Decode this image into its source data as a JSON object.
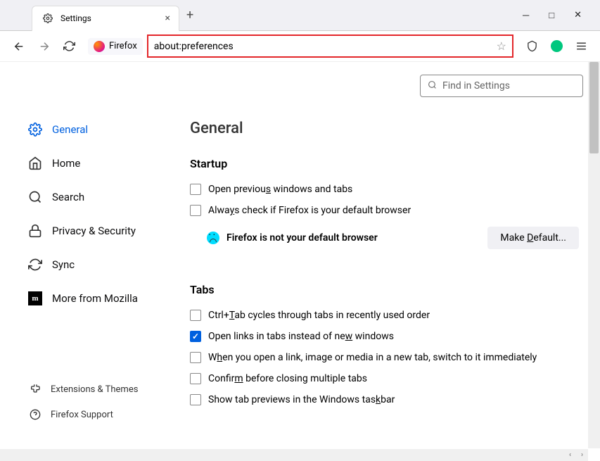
{
  "tab": {
    "title": "Settings"
  },
  "url": {
    "identity": "Firefox",
    "value": "about:preferences"
  },
  "search": {
    "placeholder": "Find in Settings"
  },
  "sidebar": {
    "general": "General",
    "home": "Home",
    "search": "Search",
    "privacy": "Privacy & Security",
    "sync": "Sync",
    "more": "More from Mozilla",
    "ext": "Extensions & Themes",
    "support": "Firefox Support"
  },
  "page": {
    "title": "General",
    "startup": {
      "heading": "Startup",
      "open_prev": "Open previous windows and tabs",
      "always_check": "Always check if Firefox is your default browser",
      "not_default": "Firefox is not your default browser",
      "make_default": "Make Default..."
    },
    "tabs": {
      "heading": "Tabs",
      "ctrl_tab": "Ctrl+Tab cycles through tabs in recently used order",
      "open_links": "Open links in tabs instead of new windows",
      "switch_to": "When you open a link, image or media in a new tab, switch to it immediately",
      "confirm": "Confirm before closing multiple tabs",
      "taskbar": "Show tab previews in the Windows taskbar"
    }
  }
}
